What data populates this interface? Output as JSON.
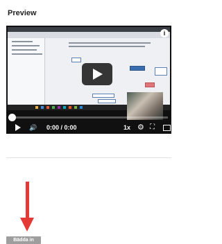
{
  "preview": {
    "title": "Preview"
  },
  "player": {
    "info_label": "i",
    "current_time": "0:00",
    "duration": "0:00",
    "time_separator": " / ",
    "speed": "1x",
    "progress": 0,
    "icons": [
      "play-icon",
      "volume-icon",
      "gear-icon",
      "fullscreen-icon",
      "cast-icon",
      "info-icon"
    ]
  },
  "embed": {
    "button_label": "Bädda in"
  },
  "colors": {
    "arrow": "#e53935",
    "embed_button": "#9e9e9e",
    "player_bg": "#101010"
  }
}
